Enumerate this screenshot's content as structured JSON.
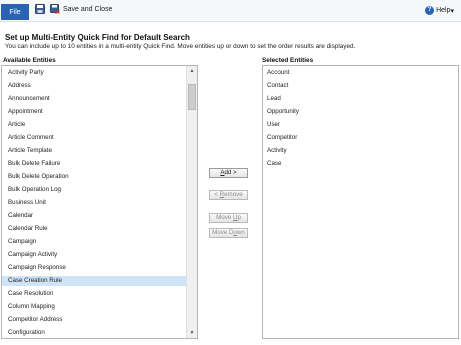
{
  "toolbar": {
    "file_label": "File",
    "save_close_label": "Save and Close",
    "help_label": "Help",
    "help_caret": "▾"
  },
  "header": {
    "title": "Set up Multi-Entity Quick Find for Default Search",
    "description": "You can include up to 10 entities in a multi-entity Quick Find. Move entities up or down to set the order results are displayed."
  },
  "available": {
    "header": "Available Entities",
    "items": [
      "Activity Party",
      "Address",
      "Announcement",
      "Appointment",
      "Article",
      "Article Comment",
      "Article Template",
      "Bulk Delete Failure",
      "Bulk Delete Operation",
      "Bulk Operation Log",
      "Business Unit",
      "Calendar",
      "Calendar Rule",
      "Campaign",
      "Campaign Activity",
      "Campaign Response",
      "Case Creation Rule",
      "Case Resolution",
      "Column Mapping",
      "Competitor Address",
      "Configuration"
    ],
    "selected_item": "Case Creation Rule"
  },
  "selected": {
    "header": "Selected Entities",
    "items": [
      "Account",
      "Contact",
      "Lead",
      "Opportunity",
      "User",
      "Competitor",
      "Activity",
      "Case"
    ]
  },
  "buttons": {
    "add": {
      "u": "A",
      "rest": "dd >"
    },
    "remove": {
      "pre": "< ",
      "u": "R",
      "rest": "emove"
    },
    "move_up": {
      "pre": "Move ",
      "u": "U",
      "rest": "p"
    },
    "move_down": {
      "pre": "Move D",
      "u": "o",
      "rest": "wn"
    }
  },
  "colors": {
    "file_button": "#2b63b4",
    "list_selection": "#cfe4f7"
  },
  "icons": {
    "save": "floppy-disk-icon",
    "save_close": "save-and-close-icon",
    "help": "help-icon"
  }
}
